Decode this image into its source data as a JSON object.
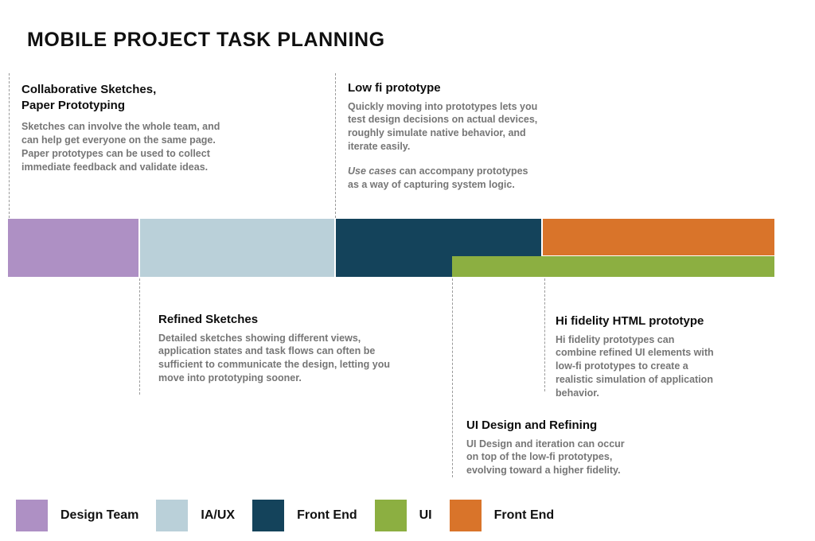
{
  "title": "MOBILE  PROJECT  TASK  PLANNING",
  "colors": {
    "design_team_purple": "#AE90C4",
    "ia_ux_lightblue": "#BAD0D9",
    "front_end_navy": "#14435B",
    "ui_green": "#8CAF41",
    "front_end_orange": "#D9742A",
    "body_text_gray": "#767676",
    "heading_black": "#0D0D0D",
    "dashed_line_gray": "#9A9A9A"
  },
  "notes": [
    {
      "id": "collaborative-sketches",
      "heading": "Collaborative Sketches,\nPaper Prototyping",
      "paragraphs": [
        "Sketches can involve the whole team, and\ncan help get everyone on the same page.\nPaper prototypes can be used to collect\nimmediate feedback and validate ideas."
      ]
    },
    {
      "id": "low-fi-prototype",
      "heading": "Low fi prototype",
      "paragraphs": [
        "Quickly moving into prototypes lets you\ntest design decisions on actual devices,\nroughly simulate native behavior, and\niterate easily."
      ],
      "paragraph_italic_lead": "Use cases",
      "paragraph_italic_rest": " can accompany prototypes\nas a way of capturing system logic."
    },
    {
      "id": "refined-sketches",
      "heading": "Refined Sketches",
      "paragraphs": [
        "Detailed sketches showing different views,\napplication states and task flows can often be\nsufficient to communicate the design, letting you\nmove into prototyping sooner."
      ]
    },
    {
      "id": "hi-fidelity-html-prototype",
      "heading": "Hi fidelity HTML prototype",
      "paragraphs": [
        "Hi fidelity prototypes can\ncombine refined UI elements with\nlow-fi prototypes to create a\nrealistic simulation of application\nbehavior."
      ]
    },
    {
      "id": "ui-design-and-refining",
      "heading": "UI Design and Refining",
      "paragraphs": [
        "UI Design and iteration can occur\non top of the low-fi prototypes,\nevolving toward a higher fidelity."
      ]
    }
  ],
  "chart_data": {
    "type": "bar",
    "title": "MOBILE  PROJECT  TASK  PLANNING",
    "orientation": "horizontal-timeline",
    "xlabel": "",
    "ylabel": "",
    "axis_units": "pixels-on-canvas",
    "xlim": [
      10,
      973
    ],
    "grid": false,
    "legend_position": "bottom",
    "segments": [
      {
        "label": "Design Team",
        "color": "#AE90C4",
        "start": 10,
        "end": 174,
        "row": 0,
        "row_span": "full"
      },
      {
        "label": "IA/UX",
        "color": "#BAD0D9",
        "start": 176,
        "end": 420,
        "row": 0,
        "row_span": "full"
      },
      {
        "label": "Front End",
        "color": "#14435B",
        "start": 422,
        "end": 680,
        "row": 0,
        "row_span": "full"
      },
      {
        "label": "Front End",
        "color": "#D9742A",
        "start": 682,
        "end": 973,
        "row": 0,
        "row_span": "upper"
      },
      {
        "label": "UI",
        "color": "#8CAF41",
        "start": 568,
        "end": 973,
        "row": 1,
        "row_span": "lower"
      }
    ],
    "milestones": [
      {
        "label": "Collaborative Sketches, Paper Prototyping",
        "x": 11
      },
      {
        "label": "Refined Sketches",
        "x": 175
      },
      {
        "label": "Low fi prototype",
        "x": 421
      },
      {
        "label": "UI Design and Refining",
        "x": 568
      },
      {
        "label": "Hi fidelity HTML prototype",
        "x": 684
      }
    ]
  },
  "legend": {
    "items": [
      {
        "label": "Design Team",
        "color": "#AE90C4"
      },
      {
        "label": "IA/UX",
        "color": "#BAD0D9"
      },
      {
        "label": "Front End",
        "color": "#14435B"
      },
      {
        "label": "UI",
        "color": "#8CAF41"
      },
      {
        "label": "Front End",
        "color": "#D9742A"
      }
    ]
  }
}
